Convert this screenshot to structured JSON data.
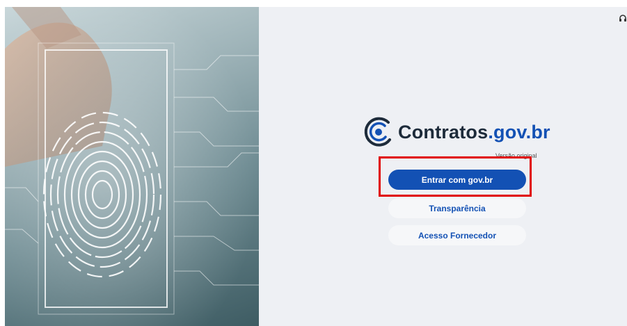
{
  "brand": {
    "name_main": "Contratos",
    "name_suffix": ".gov.br",
    "logo_icon": "gov-swirl-icon"
  },
  "version_label": "Versão original",
  "buttons": {
    "login": "Entrar com gov.br",
    "transparency": "Transparência",
    "supplier": "Acesso Fornecedor"
  },
  "hero": {
    "image": "fingerprint-biometric-image"
  },
  "icons": {
    "corner": "headset-icon"
  },
  "colors": {
    "primary": "#1351b4",
    "highlight_border": "#e00000",
    "background": "#eef0f4"
  }
}
